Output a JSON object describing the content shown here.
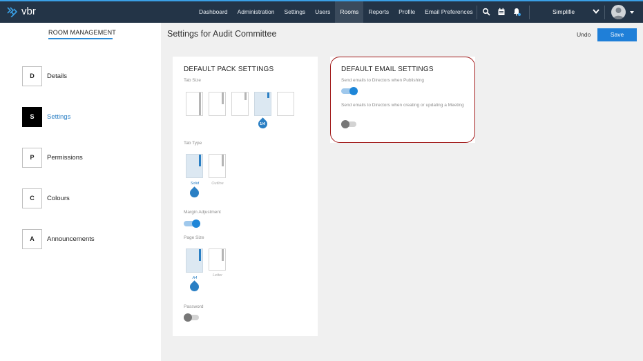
{
  "topbar": {
    "logo_text": "vbr",
    "nav": [
      "Dashboard",
      "Administration",
      "Settings",
      "Users",
      "Rooms",
      "Reports",
      "Profile",
      "Email Preferences"
    ],
    "active_nav": "Rooms",
    "tenant": "Simplifie",
    "colors": {
      "bar": "#233447",
      "accent": "#3aa0e6"
    }
  },
  "sidebar": {
    "title": "ROOM MANAGEMENT",
    "items": [
      {
        "letter": "D",
        "label": "Details"
      },
      {
        "letter": "S",
        "label": "Settings"
      },
      {
        "letter": "P",
        "label": "Permissions"
      },
      {
        "letter": "C",
        "label": "Colours"
      },
      {
        "letter": "A",
        "label": "Announcements"
      }
    ],
    "active": "Settings"
  },
  "page": {
    "title": "Settings for Audit Committee",
    "undo": "Undo",
    "save": "Save"
  },
  "pack": {
    "title": "DEFAULT PACK SETTINGS",
    "tab_size_label": "Tab Size",
    "tab_size_selected": "1/4",
    "tab_type_label": "Tab Type",
    "tab_type_options": [
      "Solid",
      "Outline"
    ],
    "tab_type_selected": "Solid",
    "margin_label": "Margin Adjustment",
    "margin_on": true,
    "page_size_label": "Page Size",
    "page_size_options": [
      "A4",
      "Letter"
    ],
    "page_size_selected": "A4",
    "password_label": "Password",
    "password_on": false
  },
  "email": {
    "title": "DEFAULT EMAIL SETTINGS",
    "publish_label": "Send emails to Directors when Publishing",
    "publish_on": true,
    "meeting_label": "Send emails to Directors when creating or updating a Meeting",
    "meeting_on": false
  }
}
